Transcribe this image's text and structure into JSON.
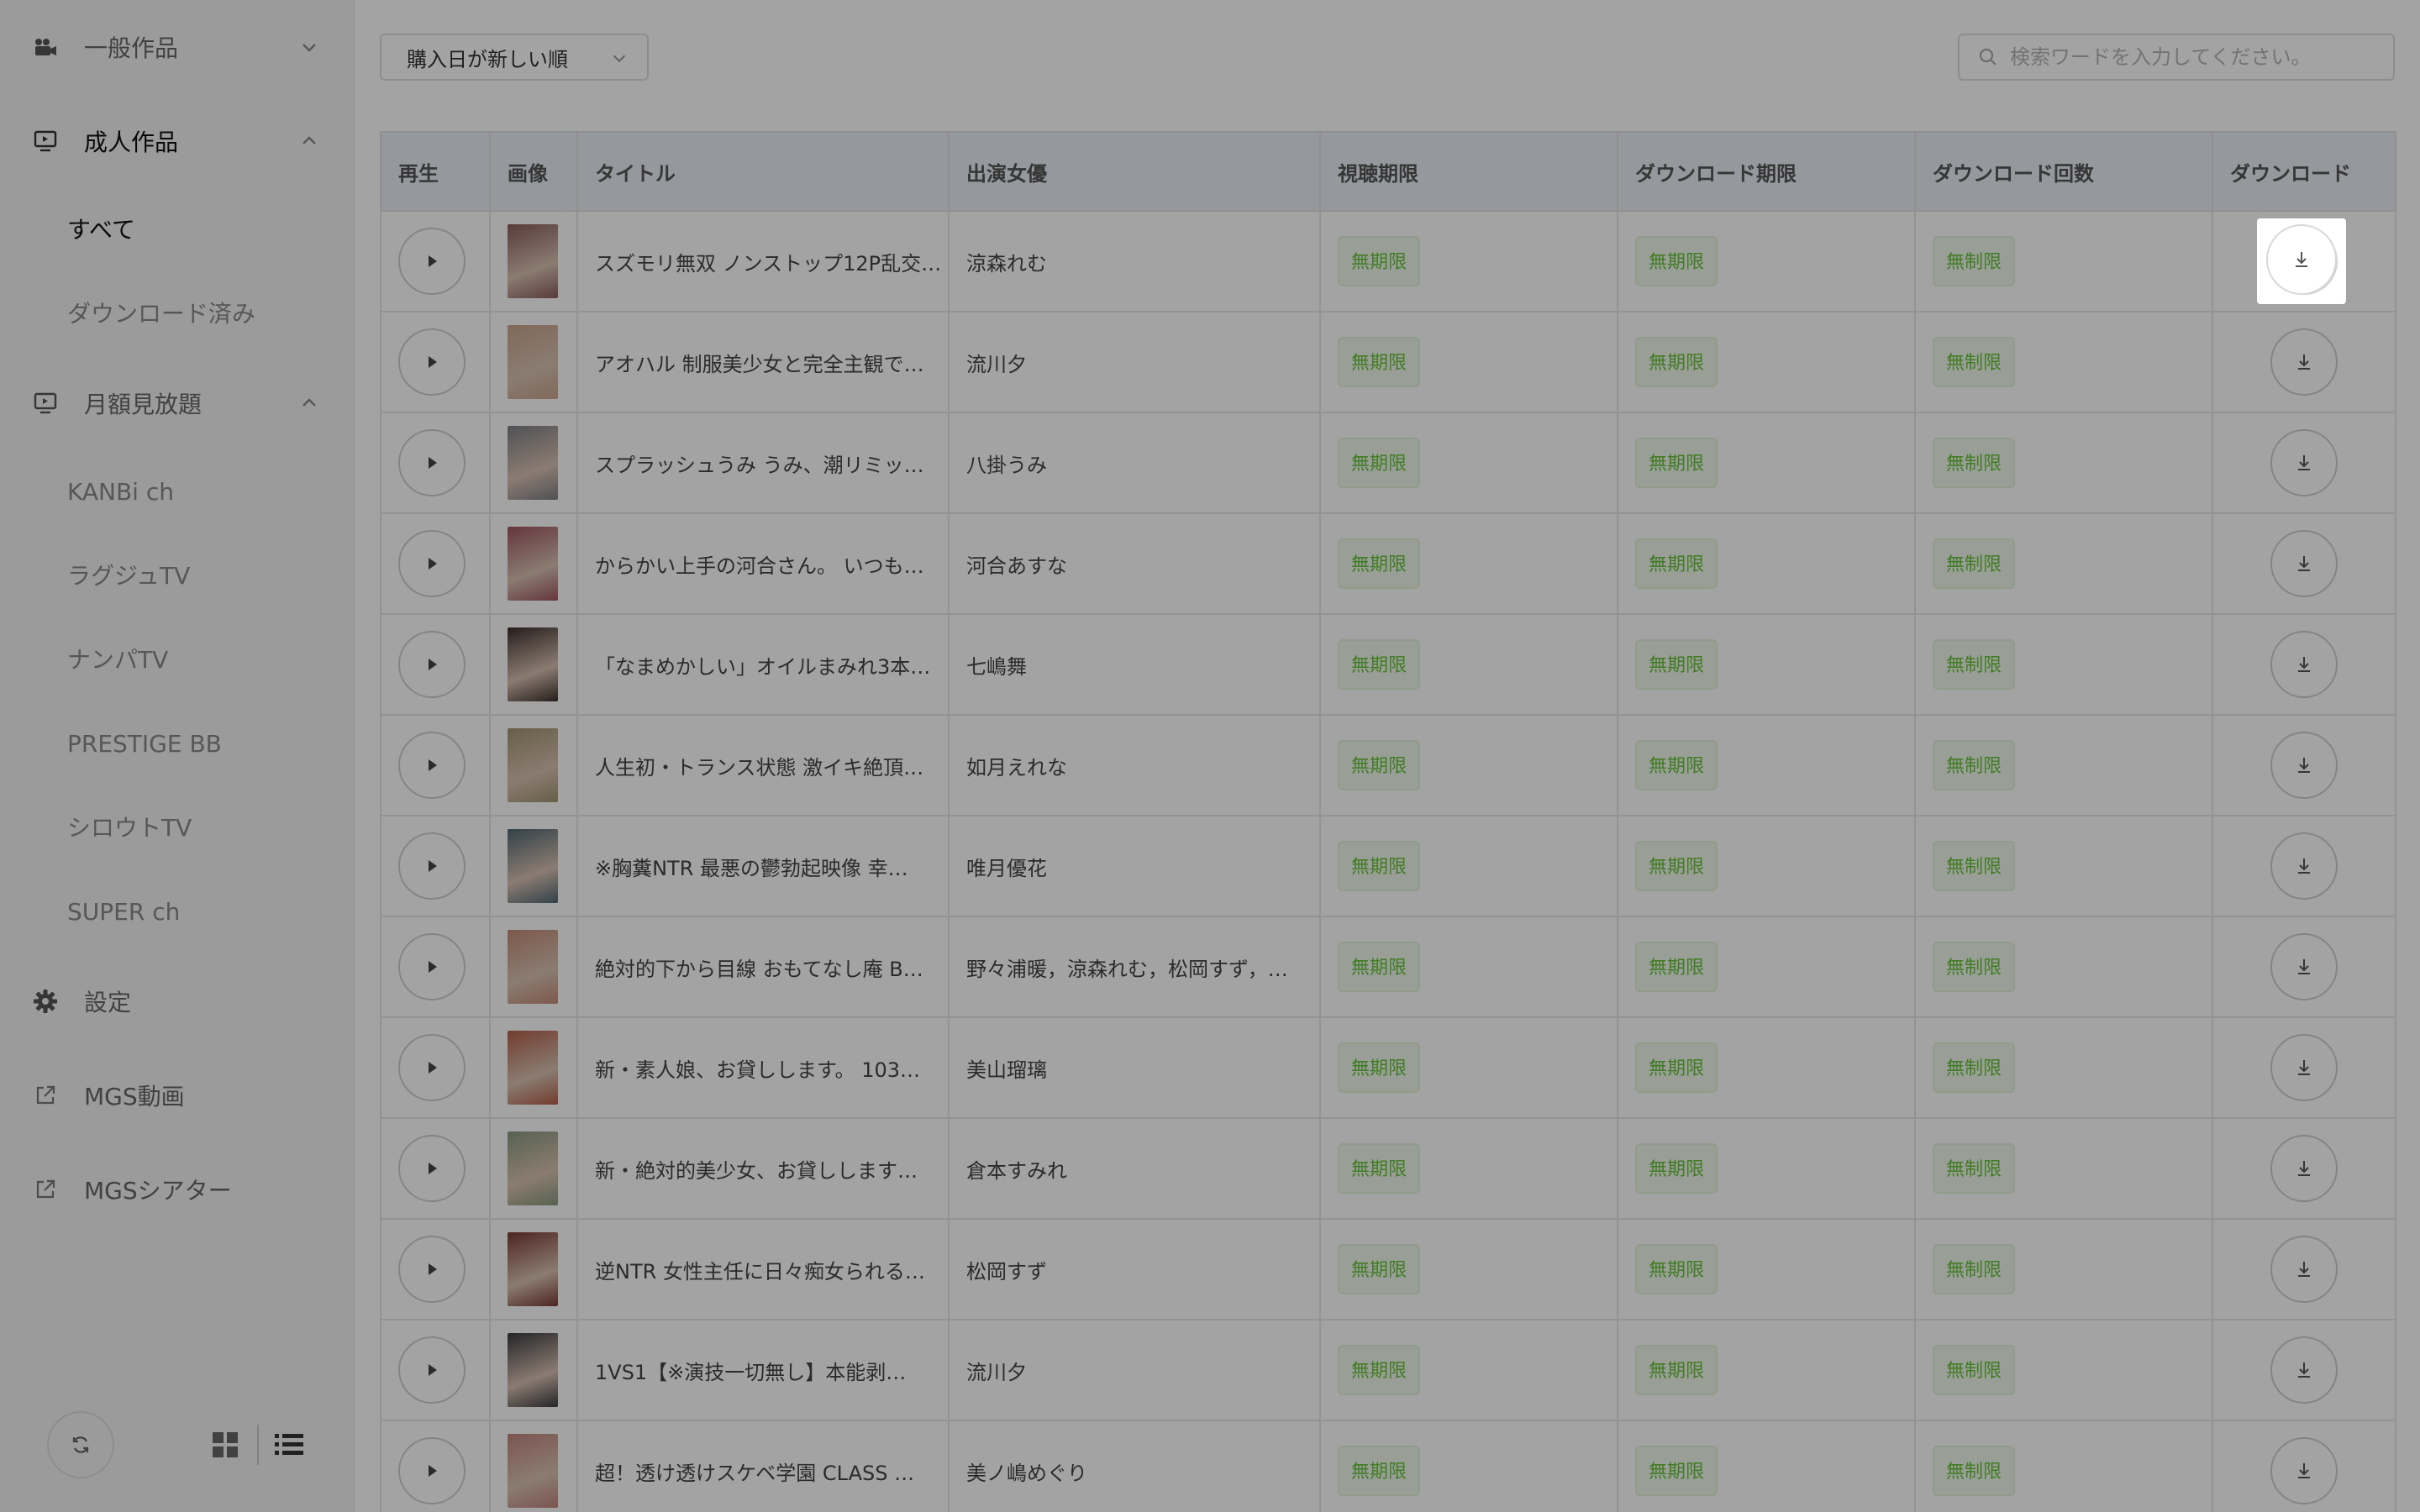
{
  "sidebar": {
    "general": {
      "label": "一般作品"
    },
    "adult": {
      "label": "成人作品",
      "items": [
        {
          "label": "すべて"
        },
        {
          "label": "ダウンロード済み"
        }
      ]
    },
    "monthly": {
      "label": "月額見放題",
      "items": [
        {
          "label": "KANBi ch"
        },
        {
          "label": "ラグジュTV"
        },
        {
          "label": "ナンパTV"
        },
        {
          "label": "PRESTIGE BB"
        },
        {
          "label": "シロウトTV"
        },
        {
          "label": "SUPER ch"
        }
      ]
    },
    "settings": {
      "label": "設定"
    },
    "links": [
      {
        "label": "MGS動画"
      },
      {
        "label": "MGSシアター"
      }
    ],
    "icons": {
      "general": "video-camera-icon",
      "adult": "monitor-icon",
      "monthly": "monitor-icon",
      "settings": "gear-icon",
      "link": "external-link-icon",
      "refresh": "refresh-icon",
      "grid": "grid-view-icon",
      "list": "list-view-icon"
    }
  },
  "toolbar": {
    "sort_value": "購入日が新しい順",
    "search_placeholder": "検索ワードを入力してください。"
  },
  "table": {
    "headers": [
      "再生",
      "画像",
      "タイトル",
      "出演女優",
      "視聴期限",
      "ダウンロード期限",
      "ダウンロード回数",
      "ダウンロード"
    ],
    "rows": [
      {
        "title": "スズモリ無双 ノンストップ12P乱交…",
        "actress": "涼森れむ",
        "view_limit": "無期限",
        "dl_limit": "無期限",
        "dl_count": "無制限",
        "thumb_color": "#8a5d5a"
      },
      {
        "title": "アオハル 制服美少女と完全主観で…",
        "actress": "流川夕",
        "view_limit": "無期限",
        "dl_limit": "無期限",
        "dl_count": "無制限",
        "thumb_color": "#c9a58e"
      },
      {
        "title": "スプラッシュうみ うみ、潮リミッ…",
        "actress": "八掛うみ",
        "view_limit": "無期限",
        "dl_limit": "無期限",
        "dl_count": "無制限",
        "thumb_color": "#7e7f86"
      },
      {
        "title": "からかい上手の河合さん。 いつも…",
        "actress": "河合あすな",
        "view_limit": "無期限",
        "dl_limit": "無期限",
        "dl_count": "無制限",
        "thumb_color": "#9e5560"
      },
      {
        "title": "「なまめかしい」オイルまみれ3本…",
        "actress": "七嶋舞",
        "view_limit": "無期限",
        "dl_limit": "無期限",
        "dl_count": "無制限",
        "thumb_color": "#3c2f2c"
      },
      {
        "title": "人生初・トランス状態 激イキ絶頂…",
        "actress": "如月えれな",
        "view_limit": "無期限",
        "dl_limit": "無期限",
        "dl_count": "無制限",
        "thumb_color": "#a39470"
      },
      {
        "title": "※胸糞NTR 最悪の鬱勃起映像 幸…",
        "actress": "唯月優花",
        "view_limit": "無期限",
        "dl_limit": "無期限",
        "dl_count": "無制限",
        "thumb_color": "#4f6773"
      },
      {
        "title": "絶対的下から目線 おもてなし庵 B…",
        "actress": "野々浦暖，涼森れむ，松岡すず，…",
        "view_limit": "無期限",
        "dl_limit": "無期限",
        "dl_count": "無制限",
        "thumb_color": "#c58b78"
      },
      {
        "title": "新・素人娘、お貸しします。 103…",
        "actress": "美山瑠璃",
        "view_limit": "無期限",
        "dl_limit": "無期限",
        "dl_count": "無制限",
        "thumb_color": "#b35f4a"
      },
      {
        "title": "新・絶対的美少女、お貸しします…",
        "actress": "倉本すみれ",
        "view_limit": "無期限",
        "dl_limit": "無期限",
        "dl_count": "無制限",
        "thumb_color": "#8a9a7e"
      },
      {
        "title": "逆NTR 女性主任に日々痴女られる…",
        "actress": "松岡すず",
        "view_limit": "無期限",
        "dl_limit": "無期限",
        "dl_count": "無制限",
        "thumb_color": "#7a3a34"
      },
      {
        "title": "1VS1【※演技一切無し】本能剥…",
        "actress": "流川夕",
        "view_limit": "無期限",
        "dl_limit": "無期限",
        "dl_count": "無制限",
        "thumb_color": "#3b3a40"
      },
      {
        "title": "超！透け透けスケベ学園 CLASS …",
        "actress": "美ノ嶋めぐり",
        "view_limit": "無期限",
        "dl_limit": "無期限",
        "dl_count": "無制限",
        "thumb_color": "#c2847e"
      }
    ]
  },
  "colors": {
    "badge_text": "#67c23a",
    "badge_bg": "#f0f9eb",
    "header_bg": "#e9eef5",
    "sidebar_bg": "#f3f3f3"
  }
}
